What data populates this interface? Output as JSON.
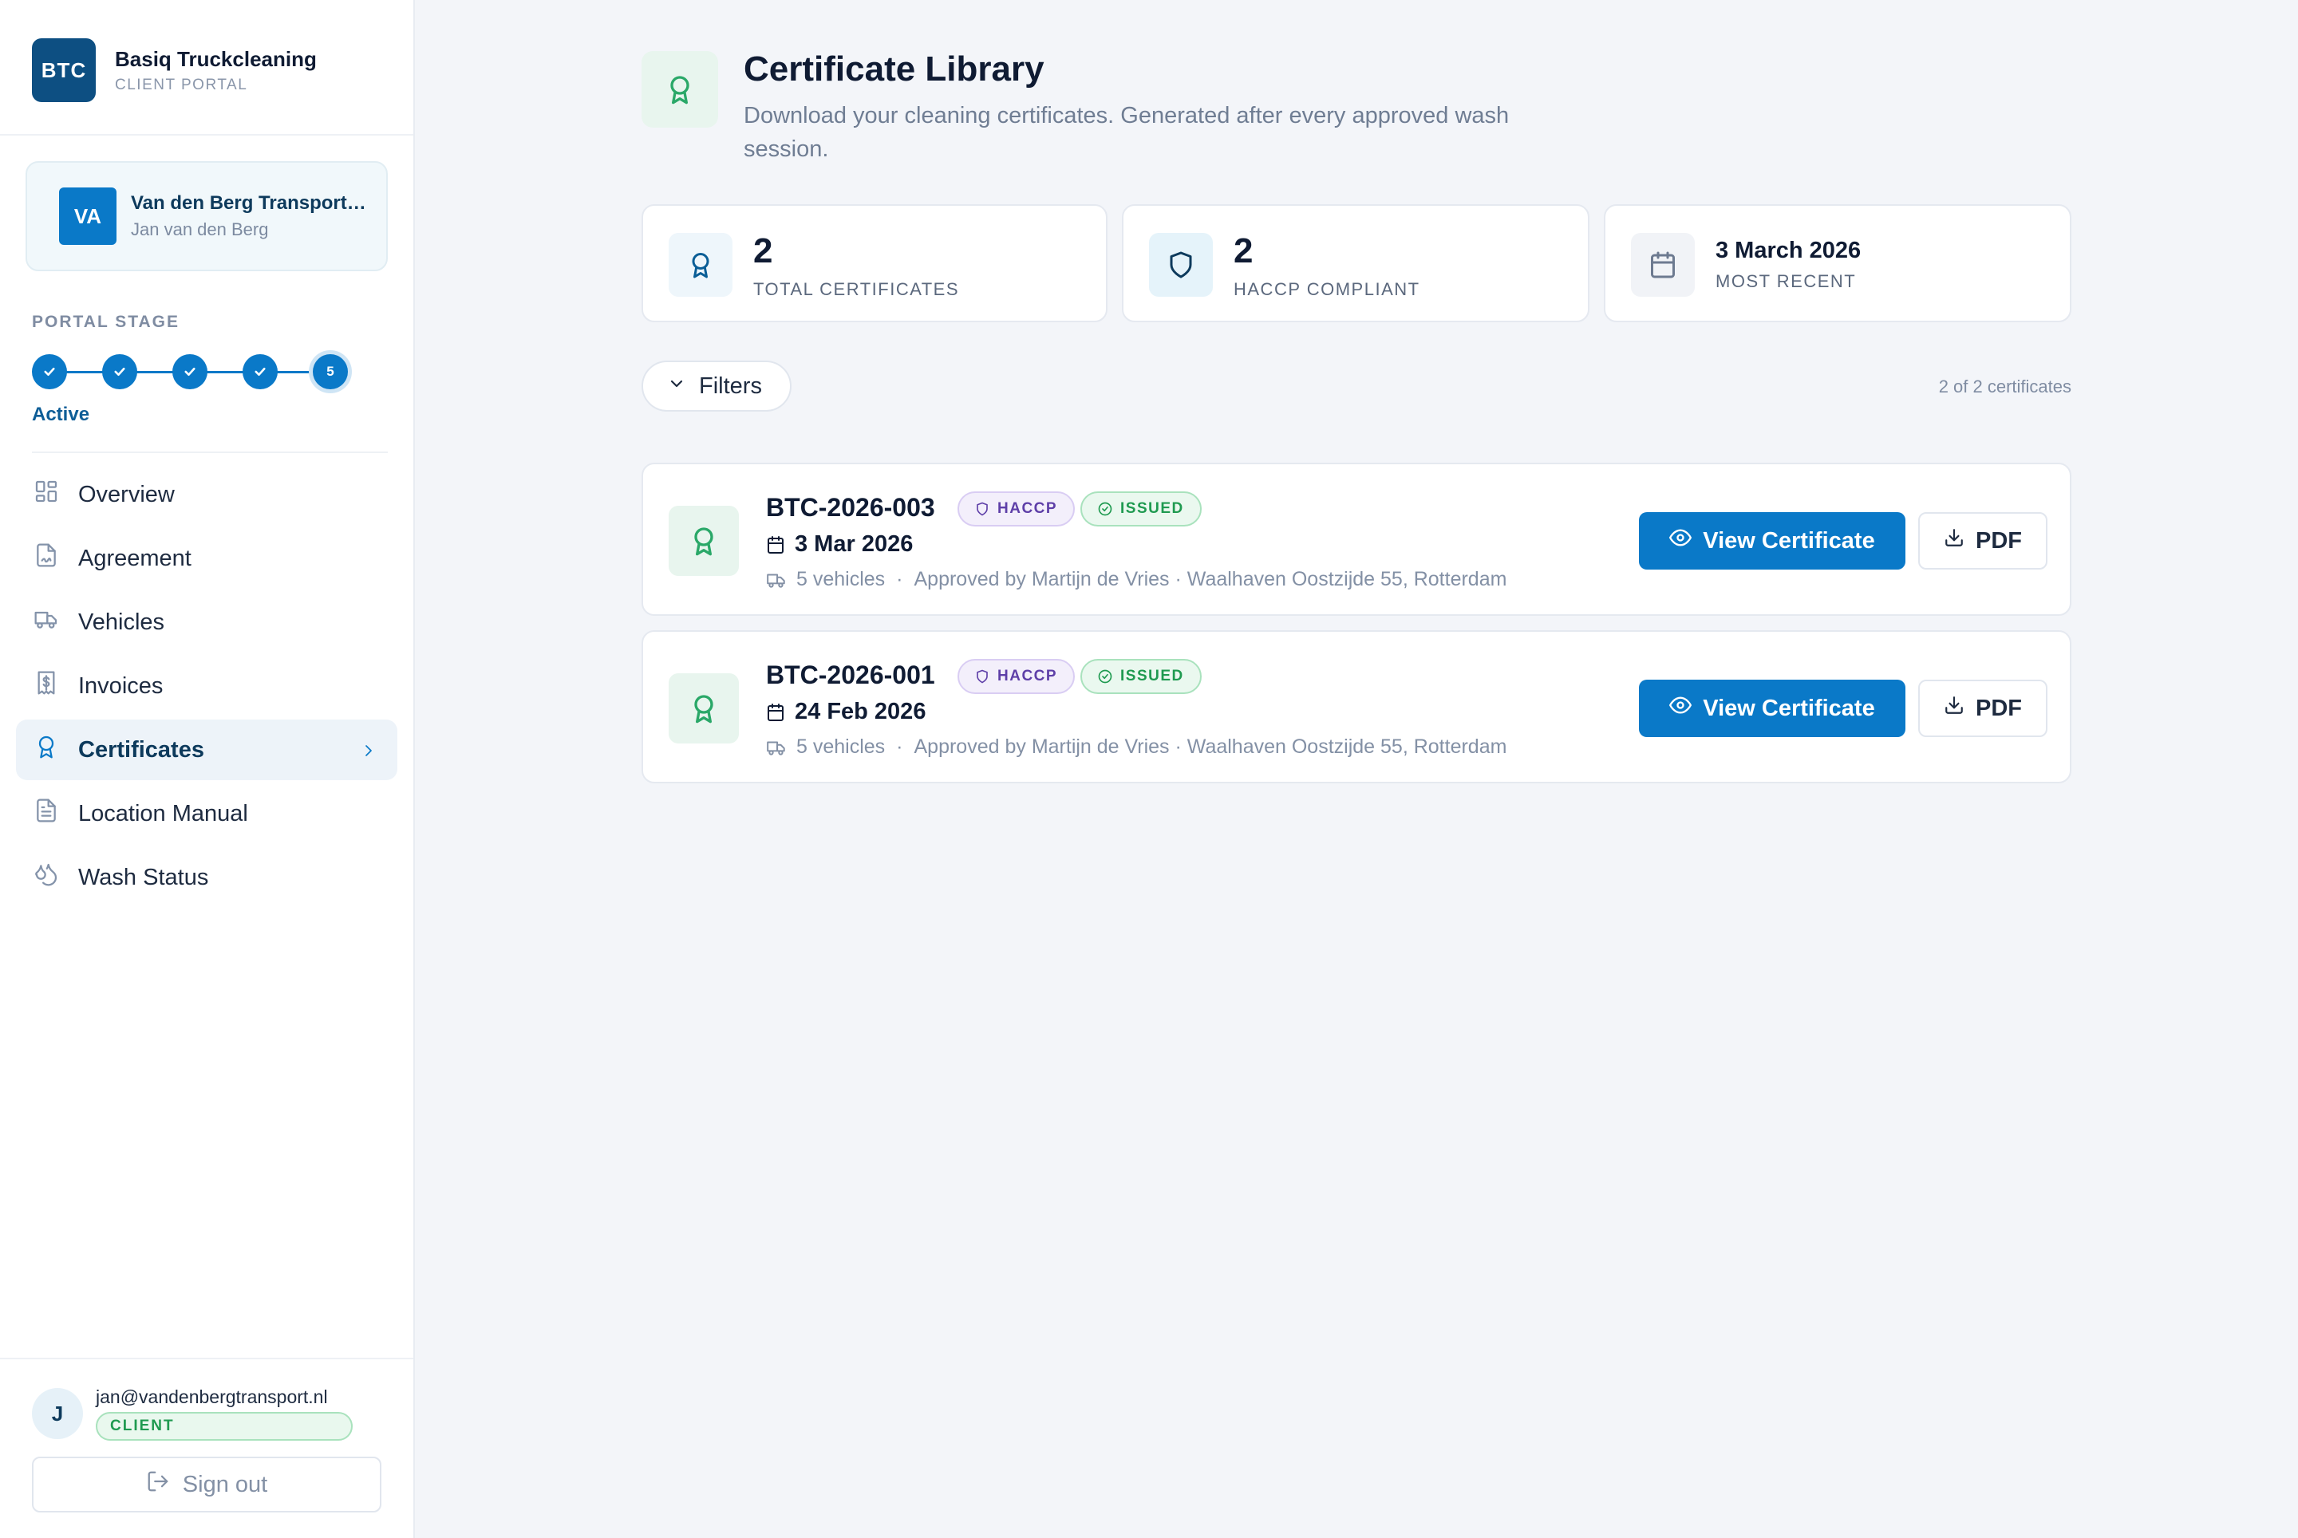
{
  "brand": {
    "logo": "BTC",
    "name": "Basiq Truckcleaning",
    "subtitle": "CLIENT PORTAL"
  },
  "account": {
    "initials": "VA",
    "company": "Van den Berg Transport…",
    "person": "Jan van den Berg"
  },
  "stage": {
    "label": "PORTAL STAGE",
    "current_step": "5",
    "status": "Active"
  },
  "nav": {
    "items": [
      {
        "label": "Overview",
        "icon": "grid-icon"
      },
      {
        "label": "Agreement",
        "icon": "signed-document-icon"
      },
      {
        "label": "Vehicles",
        "icon": "truck-icon"
      },
      {
        "label": "Invoices",
        "icon": "invoice-dollar-icon"
      },
      {
        "label": "Certificates",
        "icon": "award-icon",
        "active": true
      },
      {
        "label": "Location Manual",
        "icon": "document-icon"
      },
      {
        "label": "Wash Status",
        "icon": "droplets-icon"
      }
    ]
  },
  "user": {
    "initial": "J",
    "email": "jan@vandenbergtransport.nl",
    "role": "CLIENT",
    "signout_label": "Sign out"
  },
  "header": {
    "title": "Certificate Library",
    "subtitle": "Download your cleaning certificates. Generated after every approved wash session."
  },
  "stats": [
    {
      "value": "2",
      "label": "TOTAL CERTIFICATES",
      "icon": "award-icon"
    },
    {
      "value": "2",
      "label": "HACCP COMPLIANT",
      "icon": "shield-icon"
    },
    {
      "value": "3 March 2026",
      "label": "MOST RECENT",
      "icon": "calendar-icon"
    }
  ],
  "filters": {
    "label": "Filters",
    "count": "2 of 2 certificates"
  },
  "certificates": [
    {
      "id": "BTC-2026-003",
      "badge_haccp": "HACCP",
      "badge_status": "ISSUED",
      "date": "3 Mar 2026",
      "vehicles": "5 vehicles",
      "approval": "Approved by Martijn de Vries · Waalhaven Oostzijde 55, Rotterdam",
      "view_label": "View Certificate",
      "pdf_label": "PDF"
    },
    {
      "id": "BTC-2026-001",
      "badge_haccp": "HACCP",
      "badge_status": "ISSUED",
      "date": "24 Feb 2026",
      "vehicles": "5 vehicles",
      "approval": "Approved by Martijn de Vries · Waalhaven Oostzijde 55, Rotterdam",
      "view_label": "View Certificate",
      "pdf_label": "PDF"
    }
  ],
  "colors": {
    "primary": "#0a79c8",
    "brand_dark": "#0d4f82",
    "success": "#1f9a50",
    "haccp": "#5e3fa8"
  }
}
